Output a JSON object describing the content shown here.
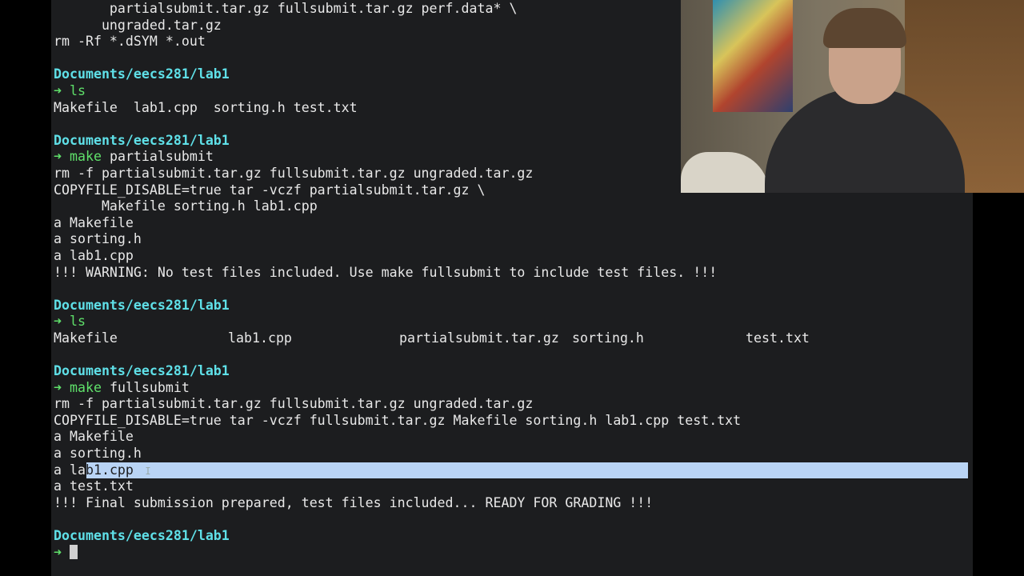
{
  "terminal": {
    "lines": [
      {
        "type": "text",
        "text": "       partialsubmit.tar.gz fullsubmit.tar.gz perf.data* \\"
      },
      {
        "type": "text",
        "text": "      ungraded.tar.gz"
      },
      {
        "type": "text",
        "text": "rm -Rf *.dSYM *.out"
      },
      {
        "type": "blank"
      },
      {
        "type": "path",
        "text": "Documents/eecs281/lab1"
      },
      {
        "type": "prompt",
        "arrow": "➜",
        "cmd": "ls",
        "args": ""
      },
      {
        "type": "text",
        "text": "Makefile  lab1.cpp  sorting.h test.txt"
      },
      {
        "type": "blank"
      },
      {
        "type": "path",
        "text": "Documents/eecs281/lab1"
      },
      {
        "type": "prompt",
        "arrow": "➜",
        "cmd": "make",
        "args": " partialsubmit"
      },
      {
        "type": "text",
        "text": "rm -f partialsubmit.tar.gz fullsubmit.tar.gz ungraded.tar.gz"
      },
      {
        "type": "text",
        "text": "COPYFILE_DISABLE=true tar -vczf partialsubmit.tar.gz \\"
      },
      {
        "type": "text",
        "text": "      Makefile sorting.h lab1.cpp"
      },
      {
        "type": "text",
        "text": "a Makefile"
      },
      {
        "type": "text",
        "text": "a sorting.h"
      },
      {
        "type": "text",
        "text": "a lab1.cpp"
      },
      {
        "type": "text",
        "text": "!!! WARNING: No test files included. Use make fullsubmit to include test files. !!!"
      },
      {
        "type": "blank"
      },
      {
        "type": "path",
        "text": "Documents/eecs281/lab1"
      },
      {
        "type": "prompt",
        "arrow": "➜",
        "cmd": "ls",
        "args": ""
      },
      {
        "type": "cols",
        "items": [
          "Makefile",
          "lab1.cpp",
          "partialsubmit.tar.gz",
          "sorting.h",
          "test.txt"
        ]
      },
      {
        "type": "blank"
      },
      {
        "type": "path",
        "text": "Documents/eecs281/lab1"
      },
      {
        "type": "prompt",
        "arrow": "➜",
        "cmd": "make",
        "args": " fullsubmit"
      },
      {
        "type": "text",
        "text": "rm -f partialsubmit.tar.gz fullsubmit.tar.gz ungraded.tar.gz"
      },
      {
        "type": "text",
        "text": "COPYFILE_DISABLE=true tar -vczf fullsubmit.tar.gz Makefile sorting.h lab1.cpp test.txt"
      },
      {
        "type": "text",
        "text": "a Makefile"
      },
      {
        "type": "text",
        "text": "a sorting.h"
      },
      {
        "type": "selected",
        "before": "a la",
        "selected": "b1.cpp"
      },
      {
        "type": "text",
        "text": "a test.txt"
      },
      {
        "type": "text",
        "text": "!!! Final submission prepared, test files included... READY FOR GRADING !!!"
      },
      {
        "type": "blank"
      },
      {
        "type": "path",
        "text": "Documents/eecs281/lab1"
      },
      {
        "type": "prompt_cursor",
        "arrow": "➜"
      }
    ]
  },
  "colors": {
    "background": "#1c1d1f",
    "path": "#5fe0e8",
    "arrow": "#5fe06a",
    "text": "#e8e8e8",
    "selection": "#b9d4f5"
  },
  "icons": {
    "ibeam": "text-cursor-icon"
  }
}
